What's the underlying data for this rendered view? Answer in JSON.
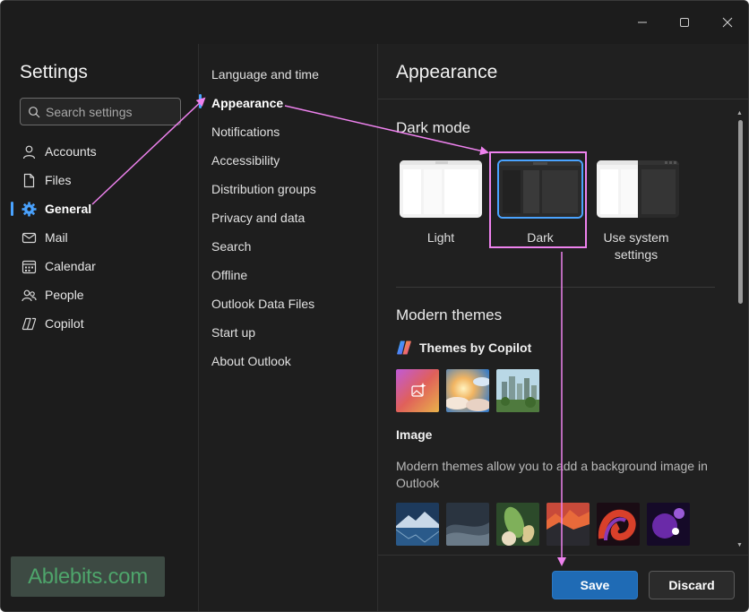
{
  "window": {
    "controls": [
      "minimize-icon",
      "maximize-icon",
      "close-icon"
    ]
  },
  "sidebar": {
    "title": "Settings",
    "search_placeholder": "Search settings",
    "items": [
      {
        "label": "Accounts",
        "icon": "person-icon"
      },
      {
        "label": "Files",
        "icon": "file-icon"
      },
      {
        "label": "General",
        "icon": "gear-icon",
        "active": true
      },
      {
        "label": "Mail",
        "icon": "mail-icon"
      },
      {
        "label": "Calendar",
        "icon": "calendar-icon"
      },
      {
        "label": "People",
        "icon": "people-icon"
      },
      {
        "label": "Copilot",
        "icon": "copilot-icon"
      }
    ]
  },
  "subnav": {
    "items": [
      {
        "label": "Language and time"
      },
      {
        "label": "Appearance",
        "active": true
      },
      {
        "label": "Notifications"
      },
      {
        "label": "Accessibility"
      },
      {
        "label": "Distribution groups"
      },
      {
        "label": "Privacy and data"
      },
      {
        "label": "Search"
      },
      {
        "label": "Offline"
      },
      {
        "label": "Outlook Data Files"
      },
      {
        "label": "Start up"
      },
      {
        "label": "About Outlook"
      }
    ]
  },
  "content": {
    "title": "Appearance",
    "dark_mode": {
      "heading": "Dark mode",
      "options": [
        {
          "label": "Light"
        },
        {
          "label": "Dark",
          "selected": true
        },
        {
          "label": "Use system settings"
        }
      ]
    },
    "modern_themes": {
      "heading": "Modern themes",
      "copilot_label": "Themes by Copilot",
      "image_heading": "Image",
      "image_description": "Modern themes allow you to add a background image in Outlook"
    }
  },
  "footer": {
    "save_label": "Save",
    "discard_label": "Discard"
  },
  "watermark": {
    "text": "Ablebits.com"
  },
  "colors": {
    "accent": "#4aa3ff",
    "save_button": "#1f6bb5",
    "annotation": "#ee82ee",
    "background": "#1f1f1f"
  }
}
